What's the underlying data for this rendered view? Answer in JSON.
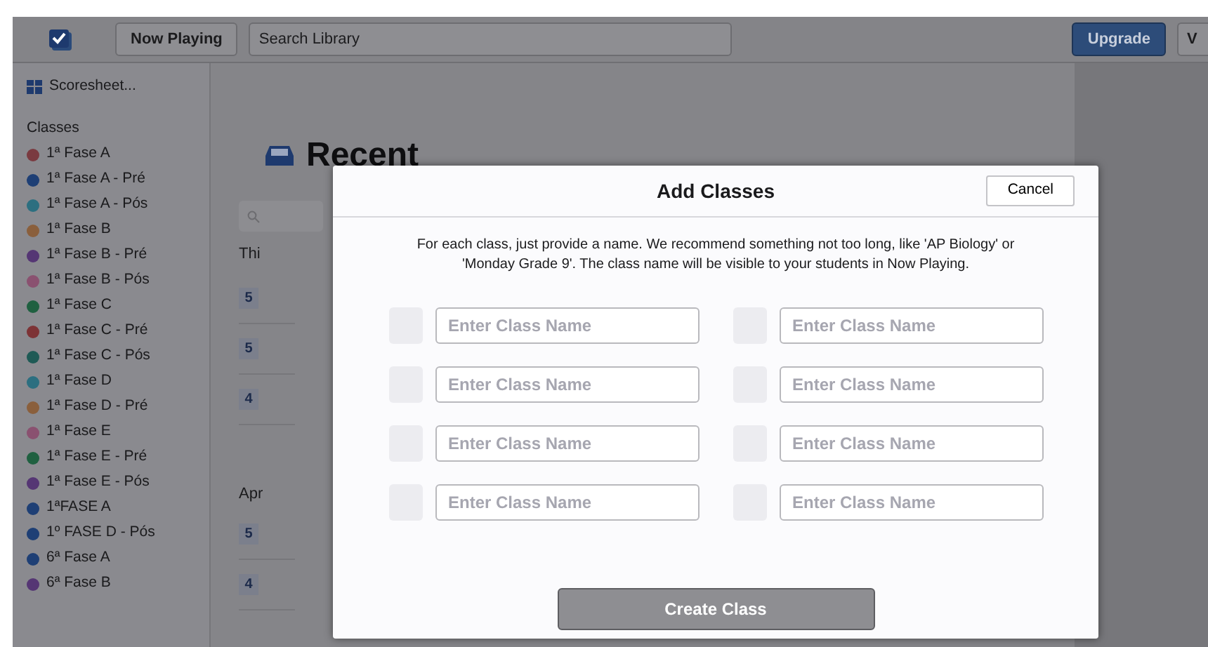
{
  "top_bar": {
    "now_playing": "Now Playing",
    "search": {
      "placeholder": "Search Library"
    },
    "upgrade": "Upgrade",
    "cut_button": "V"
  },
  "sidebar": {
    "scoresheet": "Scoresheet...",
    "heading": "Classes",
    "classes": [
      {
        "name": "1ª Fase A",
        "color": "#7a3a40"
      },
      {
        "name": "1ª Fase A - Pré",
        "color": "#1e3f75"
      },
      {
        "name": "1ª Fase A - Pós",
        "color": "#2c6f80"
      },
      {
        "name": "1ª Fase B",
        "color": "#8a5f3c"
      },
      {
        "name": "1ª Fase B - Pré",
        "color": "#553674"
      },
      {
        "name": "1ª Fase B - Pós",
        "color": "#8a5170"
      },
      {
        "name": "1ª Fase C",
        "color": "#1f6040"
      },
      {
        "name": "1ª Fase C - Pré",
        "color": "#7d3336"
      },
      {
        "name": "1ª Fase C - Pós",
        "color": "#1e5a55"
      },
      {
        "name": "1ª Fase D",
        "color": "#2c6f80"
      },
      {
        "name": "1ª Fase D - Pré",
        "color": "#8a5f3c"
      },
      {
        "name": "1ª Fase E",
        "color": "#8a5170"
      },
      {
        "name": "1ª Fase E - Pré",
        "color": "#1f6040"
      },
      {
        "name": "1ª Fase E - Pós",
        "color": "#553674"
      },
      {
        "name": "1ªFASE A",
        "color": "#1e3f75"
      },
      {
        "name": "1º FASE D - Pós",
        "color": "#1e3f75"
      },
      {
        "name": "6ª Fase A",
        "color": "#1e3f75"
      },
      {
        "name": "6ª Fase B",
        "color": "#553674"
      }
    ]
  },
  "main": {
    "title": "Recent",
    "section_1": "Thi",
    "badges_1": [
      "5",
      "5",
      "4"
    ],
    "section_2": "Apr",
    "badges_2": [
      "5",
      "4"
    ]
  },
  "modal": {
    "title": "Add Classes",
    "cancel": "Cancel",
    "description": "For each class, just provide a name. We recommend something not too long, like 'AP Biology' or 'Monday Grade 9'. The class name will be visible to your students in Now Playing.",
    "fields": [
      {
        "placeholder": "Enter Class Name"
      },
      {
        "placeholder": "Enter Class Name"
      },
      {
        "placeholder": "Enter Class Name"
      },
      {
        "placeholder": "Enter Class Name"
      },
      {
        "placeholder": "Enter Class Name"
      },
      {
        "placeholder": "Enter Class Name"
      },
      {
        "placeholder": "Enter Class Name"
      },
      {
        "placeholder": "Enter Class Name"
      }
    ],
    "create": "Create Class"
  }
}
